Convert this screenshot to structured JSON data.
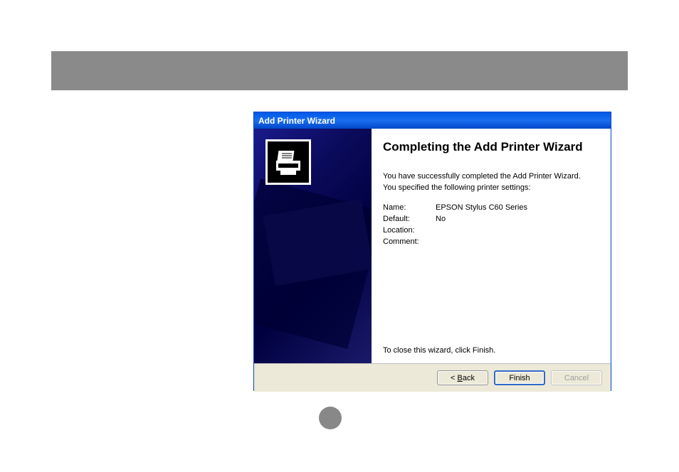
{
  "titlebar": {
    "title": "Add Printer Wizard"
  },
  "content": {
    "heading": "Completing the Add Printer Wizard",
    "line1": "You have successfully completed the Add Printer Wizard.",
    "line2": "You specified the following printer settings:",
    "settings": {
      "name_label": "Name:",
      "name_value": "EPSON Stylus C60 Series",
      "default_label": "Default:",
      "default_value": "No",
      "location_label": "Location:",
      "location_value": "",
      "comment_label": "Comment:",
      "comment_value": ""
    },
    "close_text": "To close this wizard, click Finish."
  },
  "buttons": {
    "back_prefix": "< ",
    "back_letter": "B",
    "back_rest": "ack",
    "finish": "Finish",
    "cancel": "Cancel"
  }
}
